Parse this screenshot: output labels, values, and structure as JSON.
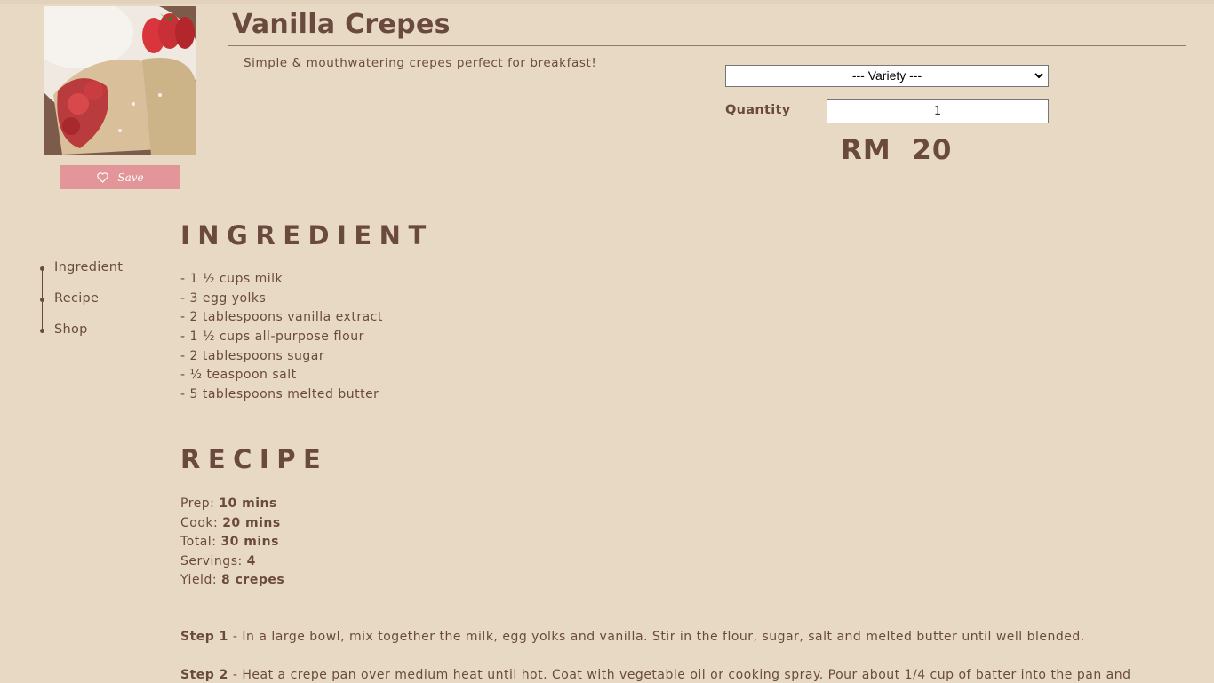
{
  "product": {
    "title": "Vanilla Crepes",
    "description": "Simple & mouthwatering crepes perfect for breakfast!",
    "save_label": "Save",
    "image_icon": "crepe-photo"
  },
  "order": {
    "variety_selected": "--- Variety ---",
    "quantity_label": "Quantity",
    "quantity_value": "1",
    "price_currency": "RM",
    "price_value": "20",
    "price_text": "RM  20"
  },
  "nav": {
    "items": [
      {
        "label": "Ingredient"
      },
      {
        "label": "Recipe"
      },
      {
        "label": "Shop"
      }
    ]
  },
  "ingredients": {
    "heading": "INGREDIENT",
    "items": [
      "- 1 ½ cups milk",
      "- 3 egg yolks",
      "- 2 tablespoons vanilla extract",
      "- 1 ½ cups all-purpose flour",
      "- 2 tablespoons sugar",
      "- ½ teaspoon salt",
      "- 5 tablespoons melted butter"
    ]
  },
  "recipe": {
    "heading": "RECIPE",
    "meta": [
      {
        "label": "Prep: ",
        "value": "10 mins"
      },
      {
        "label": "Cook: ",
        "value": "20 mins"
      },
      {
        "label": "Total: ",
        "value": "30 mins"
      },
      {
        "label": "Servings: ",
        "value": "4"
      },
      {
        "label": "Yield: ",
        "value": "8 crepes"
      }
    ],
    "steps": [
      {
        "label": "Step 1",
        "text": " - In a large bowl, mix together the milk, egg yolks and vanilla. Stir in the flour, sugar, salt and melted butter until well blended."
      },
      {
        "label": "Step 2",
        "text": " - Heat a crepe pan over medium heat until hot. Coat with vegetable oil or cooking spray. Pour about 1/4 cup of batter into the pan and"
      }
    ]
  },
  "colors": {
    "background": "#e8d9c4",
    "text": "#6b4a3e",
    "save_button": "#e3969a"
  }
}
